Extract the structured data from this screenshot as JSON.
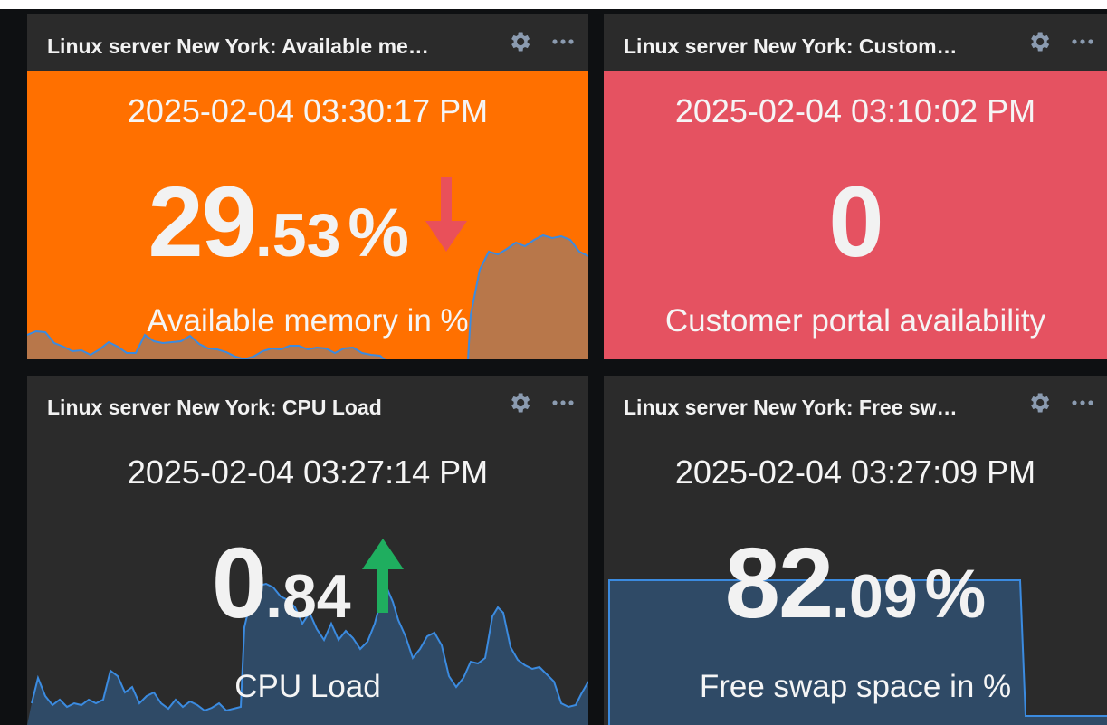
{
  "widgets": [
    {
      "title": "Linux server New York: Available me…",
      "time": "2025-02-04 03:30:17 PM",
      "value_int": "29",
      "value_dec": ".53",
      "unit": "%",
      "description": "Available memory in %",
      "trend": "down",
      "trend_color": "#e9505a",
      "bg_color": "#ff7000",
      "icons": [
        "gear-icon",
        "more-dots-icon",
        "arrow-down-icon"
      ]
    },
    {
      "title": "Linux server New York: Custom…",
      "time": "2025-02-04 03:10:02 PM",
      "value_int": "0",
      "value_dec": "",
      "unit": "",
      "description": "Customer portal availability",
      "trend": "none",
      "bg_color": "#e55261",
      "icons": [
        "gear-icon",
        "more-dots-icon"
      ]
    },
    {
      "title": "Linux server New York: CPU Load",
      "time": "2025-02-04 03:27:14 PM",
      "value_int": "0",
      "value_dec": ".84",
      "unit": "",
      "description": "CPU Load",
      "trend": "up",
      "trend_color": "#1fae5f",
      "bg_color": "#2b2b2b",
      "icons": [
        "gear-icon",
        "more-dots-icon",
        "arrow-up-icon"
      ]
    },
    {
      "title": "Linux server New York: Free sw…",
      "time": "2025-02-04 03:27:09 PM",
      "value_int": "82",
      "value_dec": ".09",
      "unit": "%",
      "description": "Free swap space in %",
      "trend": "none",
      "bg_color": "#2b2b2b",
      "icons": [
        "gear-icon",
        "more-dots-icon"
      ]
    }
  ]
}
